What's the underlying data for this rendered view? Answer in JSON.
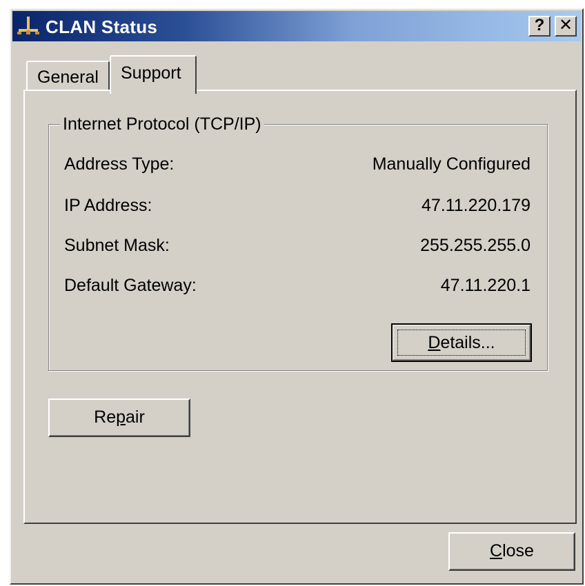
{
  "window": {
    "title": "CLAN Status",
    "title_icon": "network-connection-icon",
    "help_button": "?",
    "close_button": "✕"
  },
  "tabs": [
    {
      "label": "General",
      "active": false
    },
    {
      "label": "Support",
      "active": true
    }
  ],
  "group": {
    "legend": "Internet Protocol (TCP/IP)",
    "rows": [
      {
        "label": "Address Type:",
        "value": "Manually Configured"
      },
      {
        "label": "IP Address:",
        "value": "47.11.220.179"
      },
      {
        "label": "Subnet Mask:",
        "value": "255.255.255.0"
      },
      {
        "label": "Default Gateway:",
        "value": "47.11.220.1"
      }
    ],
    "details_button": {
      "before": "",
      "accel": "D",
      "after": "etails..."
    }
  },
  "repair_button": {
    "before": "Re",
    "accel": "p",
    "after": "air"
  },
  "close_button": {
    "before": "",
    "accel": "C",
    "after": "lose"
  }
}
